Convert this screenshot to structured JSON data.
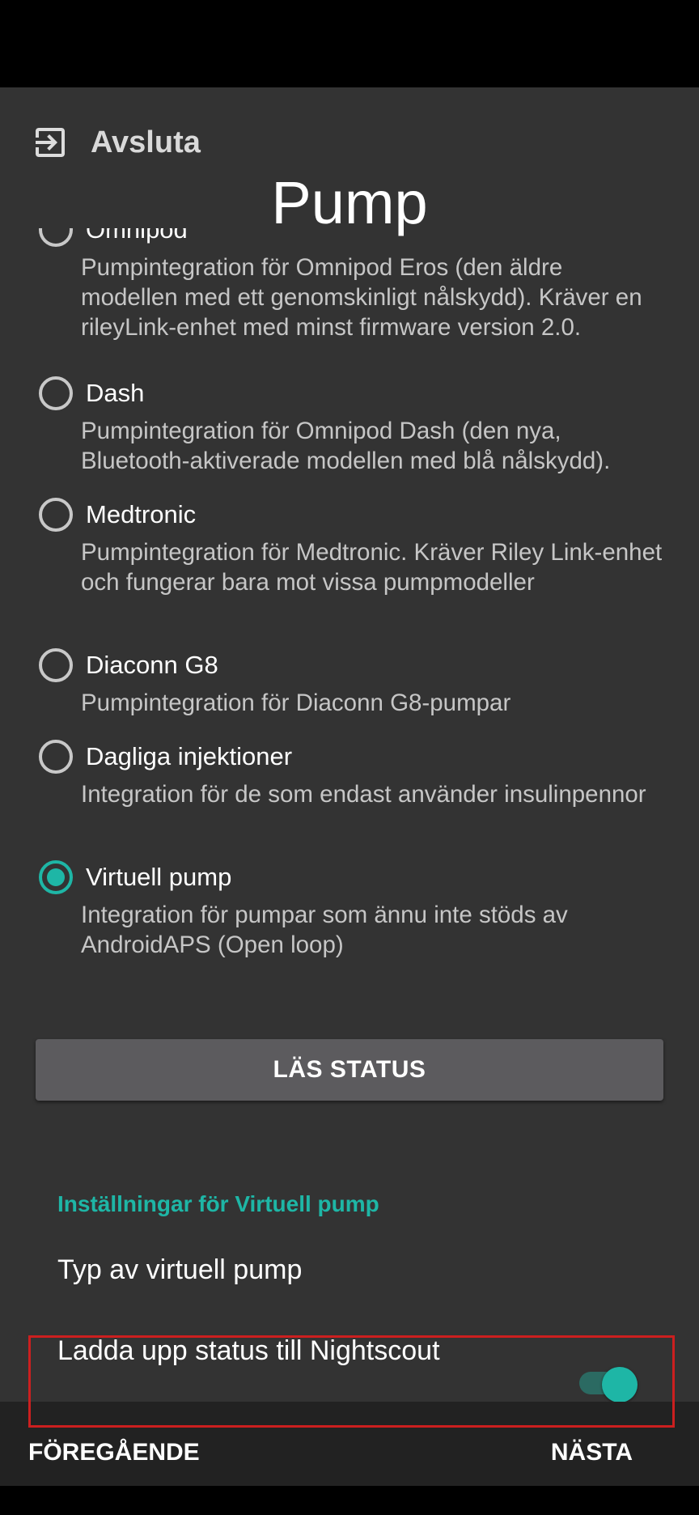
{
  "header": {
    "exit_label": "Avsluta",
    "exit_icon": "exit-icon",
    "title": "Pump"
  },
  "options": [
    {
      "label": "Omnipod",
      "description": "Pumpintegration för Omnipod Eros (den äldre modellen med ett genomskinligt nålskydd). Kräver en rileyLink-enhet med minst firmware version 2.0.",
      "checked": false
    },
    {
      "label": "Dash",
      "description": "Pumpintegration för Omnipod Dash (den nya, Bluetooth-aktiverade modellen med blå nålskydd).",
      "checked": false
    },
    {
      "label": "Medtronic",
      "description": "Pumpintegration för Medtronic. Kräver Riley Link-enhet och fungerar bara mot vissa pumpmodeller",
      "checked": false
    },
    {
      "label": "Diaconn G8",
      "description": "Pumpintegration för Diaconn G8-pumpar",
      "checked": false
    },
    {
      "label": "Dagliga injektioner",
      "description": "Integration för de som endast använder insulinpennor",
      "checked": false
    },
    {
      "label": "Virtuell pump",
      "description": "Integration för pumpar som ännu inte stöds av AndroidAPS (Open loop)",
      "checked": true
    }
  ],
  "read_status_label": "LÄS STATUS",
  "settings": {
    "section_header": "Inställningar för Virtuell pump",
    "type_label": "Typ av virtuell pump",
    "upload_label": "Ladda upp status till Nightscout",
    "upload_enabled": true
  },
  "footer": {
    "previous_label": "FÖREGÅENDE",
    "next_label": "NÄSTA"
  },
  "colors": {
    "accent": "#1eb6a6",
    "background": "#333333",
    "highlight": "#cc1f1f"
  }
}
